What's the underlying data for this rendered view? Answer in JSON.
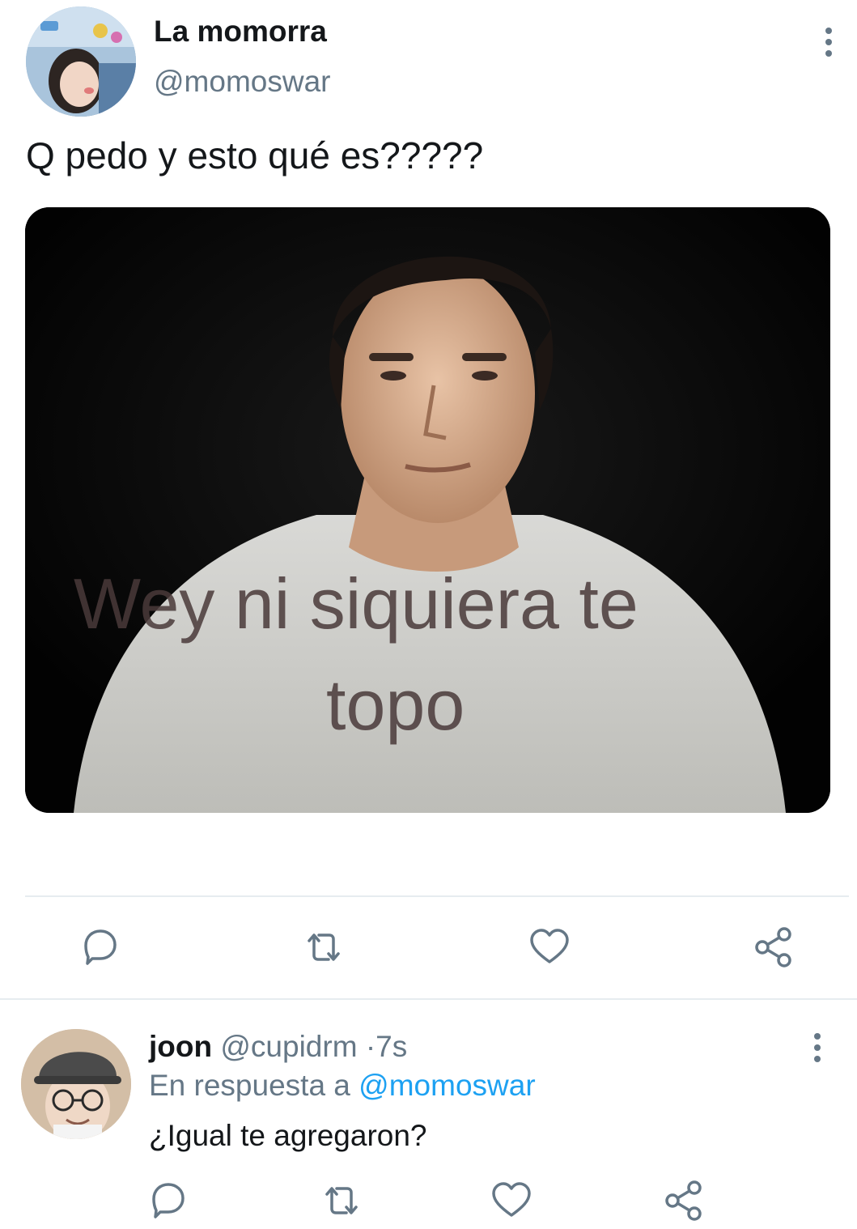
{
  "tweet": {
    "display_name": "La momorra",
    "handle": "@momoswar",
    "text": "Q pedo y esto qué es?????",
    "media": {
      "caption_line1": "Wey ni siquiera te",
      "caption_line2": "topo"
    }
  },
  "actions": {
    "icons": [
      "reply-icon",
      "retweet-icon",
      "like-icon",
      "share-icon"
    ]
  },
  "reply": {
    "display_name": "joon",
    "handle": "@cupidrm",
    "separator": "·",
    "time": "7s",
    "in_reply_prefix": "En respuesta a",
    "in_reply_mention": "@momoswar",
    "text": "¿Igual te agregaron?"
  },
  "colors": {
    "text_primary": "#14171a",
    "text_secondary": "#657786",
    "link": "#1da1f2",
    "divider": "#e6ecf0",
    "icon": "#657786"
  }
}
